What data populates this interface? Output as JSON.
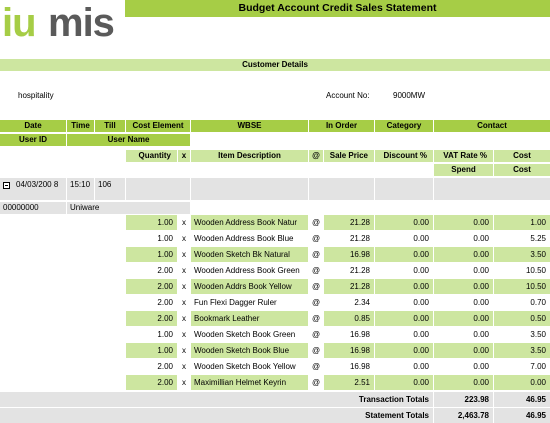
{
  "brand": {
    "logo_text": "iumis",
    "accent": "#a6cd46",
    "accent_light": "#cde6a0",
    "gray": "#e3e3e3",
    "logo_gray": "#5a5a5a"
  },
  "report": {
    "title": "Budget Account Credit Sales Statement"
  },
  "customer": {
    "section_label": "Customer Details",
    "name": "hospitality",
    "account_label": "Account No:",
    "account_value": "9000MW"
  },
  "headers": {
    "row1": {
      "date": "Date",
      "time": "Time",
      "till": "Till",
      "cost_element": "Cost Element",
      "wbse": "WBSE",
      "in_order": "In Order",
      "category": "Category",
      "contact": "Contact"
    },
    "row2": {
      "user_id": "User ID",
      "user_name": "User Name"
    },
    "row3": {
      "quantity": "Quantity",
      "x": "x",
      "item_description": "Item Description",
      "at": "@",
      "sale_price": "Sale Price",
      "discount": "Discount %",
      "vat_rate": "VAT Rate %",
      "cost": "Cost"
    },
    "row4": {
      "spend": "Spend",
      "cost": "Cost"
    }
  },
  "transaction": {
    "toggle_icon": "minus-square-icon",
    "date": "04/03/200 8",
    "time": "15:10",
    "till": "106",
    "user_id": "00000000",
    "user_name": "Uniware"
  },
  "items": [
    {
      "qty": "1.00",
      "x": "x",
      "desc": "Wooden Address Book Natur",
      "at": "@",
      "price": "21.28",
      "discount": "0.00",
      "vat": "0.00",
      "cost": "1.00"
    },
    {
      "qty": "1.00",
      "x": "x",
      "desc": "Wooden Address Book Blue",
      "at": "@",
      "price": "21.28",
      "discount": "0.00",
      "vat": "0.00",
      "cost": "5.25"
    },
    {
      "qty": "1.00",
      "x": "x",
      "desc": "Wooden Sketch Bk Natural",
      "at": "@",
      "price": "16.98",
      "discount": "0.00",
      "vat": "0.00",
      "cost": "3.50"
    },
    {
      "qty": "2.00",
      "x": "x",
      "desc": "Wooden Address Book Green",
      "at": "@",
      "price": "21.28",
      "discount": "0.00",
      "vat": "0.00",
      "cost": "10.50"
    },
    {
      "qty": "2.00",
      "x": "x",
      "desc": "Wooden Addrs Book Yellow",
      "at": "@",
      "price": "21.28",
      "discount": "0.00",
      "vat": "0.00",
      "cost": "10.50"
    },
    {
      "qty": "2.00",
      "x": "x",
      "desc": "Fun Flexi Dagger Ruler",
      "at": "@",
      "price": "2.34",
      "discount": "0.00",
      "vat": "0.00",
      "cost": "0.70"
    },
    {
      "qty": "2.00",
      "x": "x",
      "desc": "Bookmark Leather",
      "at": "@",
      "price": "0.85",
      "discount": "0.00",
      "vat": "0.00",
      "cost": "0.50"
    },
    {
      "qty": "1.00",
      "x": "x",
      "desc": "Wooden Sketch Book Green",
      "at": "@",
      "price": "16.98",
      "discount": "0.00",
      "vat": "0.00",
      "cost": "3.50"
    },
    {
      "qty": "1.00",
      "x": "x",
      "desc": "Wooden Sketch Book Blue",
      "at": "@",
      "price": "16.98",
      "discount": "0.00",
      "vat": "0.00",
      "cost": "3.50"
    },
    {
      "qty": "2.00",
      "x": "x",
      "desc": "Wooden Sketch Book Yellow",
      "at": "@",
      "price": "16.98",
      "discount": "0.00",
      "vat": "0.00",
      "cost": "7.00"
    },
    {
      "qty": "2.00",
      "x": "x",
      "desc": "Maximillian Helmet Keyrin",
      "at": "@",
      "price": "2.51",
      "discount": "0.00",
      "vat": "0.00",
      "cost": "0.00"
    }
  ],
  "totals": {
    "transaction": {
      "label": "Transaction Totals",
      "spend": "223.98",
      "cost": "46.95"
    },
    "statement": {
      "label": "Statement Totals",
      "spend": "2,463.78",
      "cost": "46.95"
    }
  }
}
